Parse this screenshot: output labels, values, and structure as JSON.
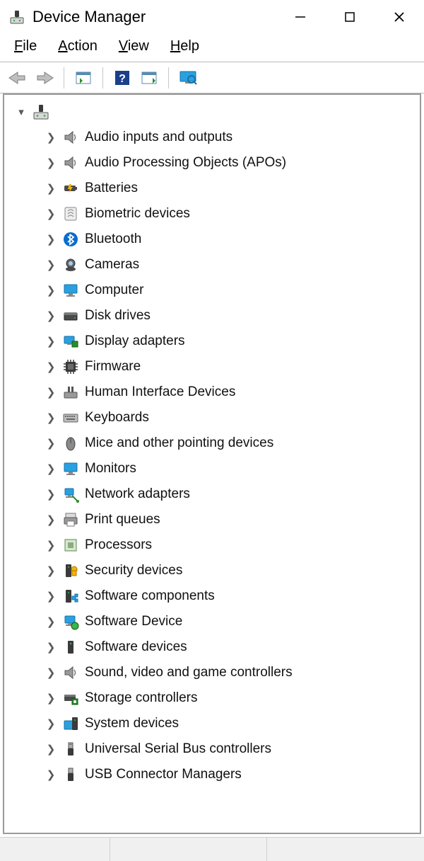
{
  "window": {
    "title": "Device Manager"
  },
  "menu": {
    "file": {
      "label": "File",
      "hotkey_index": 0
    },
    "action": {
      "label": "Action",
      "hotkey_index": 0
    },
    "view": {
      "label": "View",
      "hotkey_index": 0
    },
    "help": {
      "label": "Help",
      "hotkey_index": 0
    }
  },
  "toolbar": {
    "back": "Back",
    "forward": "Forward",
    "properties": "Properties",
    "help": "Help",
    "scan": "Scan for hardware changes",
    "monitor": "Add legacy hardware"
  },
  "tree": {
    "root": {
      "label": "",
      "expanded": true,
      "icon": "computer-root-icon"
    },
    "categories": [
      {
        "label": "Audio inputs and outputs",
        "icon": "speaker-icon"
      },
      {
        "label": "Audio Processing Objects (APOs)",
        "icon": "speaker-icon"
      },
      {
        "label": "Batteries",
        "icon": "battery-icon"
      },
      {
        "label": "Biometric devices",
        "icon": "fingerprint-icon"
      },
      {
        "label": "Bluetooth",
        "icon": "bluetooth-icon"
      },
      {
        "label": "Cameras",
        "icon": "camera-icon"
      },
      {
        "label": "Computer",
        "icon": "monitor-icon"
      },
      {
        "label": "Disk drives",
        "icon": "disk-icon"
      },
      {
        "label": "Display adapters",
        "icon": "display-adapter-icon"
      },
      {
        "label": "Firmware",
        "icon": "chip-icon"
      },
      {
        "label": "Human Interface Devices",
        "icon": "hid-icon"
      },
      {
        "label": "Keyboards",
        "icon": "keyboard-icon"
      },
      {
        "label": "Mice and other pointing devices",
        "icon": "mouse-icon"
      },
      {
        "label": "Monitors",
        "icon": "monitor-icon"
      },
      {
        "label": "Network adapters",
        "icon": "network-icon"
      },
      {
        "label": "Print queues",
        "icon": "printer-icon"
      },
      {
        "label": "Processors",
        "icon": "cpu-icon"
      },
      {
        "label": "Security devices",
        "icon": "security-icon"
      },
      {
        "label": "Software components",
        "icon": "component-icon"
      },
      {
        "label": "Software Device",
        "icon": "software-device-icon"
      },
      {
        "label": "Software devices",
        "icon": "software-devices-icon"
      },
      {
        "label": "Sound, video and game controllers",
        "icon": "speaker-icon"
      },
      {
        "label": "Storage controllers",
        "icon": "storage-controller-icon"
      },
      {
        "label": "System devices",
        "icon": "system-icon"
      },
      {
        "label": "Universal Serial Bus controllers",
        "icon": "usb-icon"
      },
      {
        "label": "USB Connector Managers",
        "icon": "usb-connector-icon"
      }
    ]
  }
}
